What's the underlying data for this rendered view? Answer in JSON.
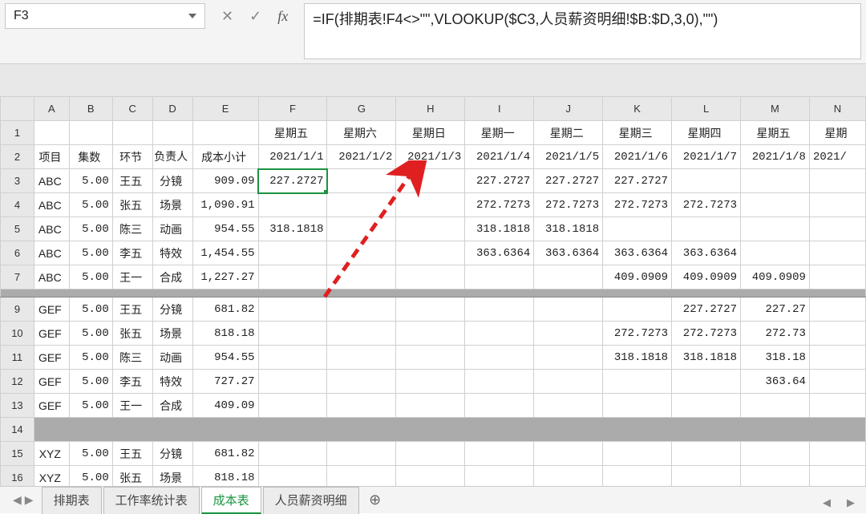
{
  "namebox": {
    "cell_ref": "F3"
  },
  "formula": "=IF(排期表!F4<>\"\",VLOOKUP($C3,人员薪资明细!$B:$D,3,0),\"\")",
  "col_headers": [
    "A",
    "B",
    "C",
    "D",
    "E",
    "F",
    "G",
    "H",
    "I",
    "J",
    "K",
    "L",
    "M",
    "N"
  ],
  "row1_headers": {
    "F": "星期五",
    "G": "星期六",
    "H": "星期日",
    "I": "星期一",
    "J": "星期二",
    "K": "星期三",
    "L": "星期四",
    "M": "星期五",
    "N": "星期"
  },
  "row2": {
    "A": "项目",
    "B": "集数",
    "C": "环节",
    "D": "负责人",
    "E": "成本小计",
    "F": "2021/1/1",
    "G": "2021/1/2",
    "H": "2021/1/3",
    "I": "2021/1/4",
    "J": "2021/1/5",
    "K": "2021/1/6",
    "L": "2021/1/7",
    "M": "2021/1/8",
    "N": "2021/"
  },
  "rows": [
    {
      "r": 3,
      "A": "ABC",
      "B": "5.00",
      "C": "王五",
      "D": "分镜",
      "E": "909.09",
      "F": "227.2727",
      "I": "227.2727",
      "J": "227.2727",
      "K": "227.2727"
    },
    {
      "r": 4,
      "A": "ABC",
      "B": "5.00",
      "C": "张五",
      "D": "场景",
      "E": "1,090.91",
      "I": "272.7273",
      "J": "272.7273",
      "K": "272.7273",
      "L": "272.7273"
    },
    {
      "r": 5,
      "A": "ABC",
      "B": "5.00",
      "C": "陈三",
      "D": "动画",
      "E": "954.55",
      "F": "318.1818",
      "I": "318.1818",
      "J": "318.1818"
    },
    {
      "r": 6,
      "A": "ABC",
      "B": "5.00",
      "C": "李五",
      "D": "特效",
      "E": "1,454.55",
      "I": "363.6364",
      "J": "363.6364",
      "K": "363.6364",
      "L": "363.6364"
    },
    {
      "r": 7,
      "A": "ABC",
      "B": "5.00",
      "C": "王一",
      "D": "合成",
      "E": "1,227.27",
      "K": "409.0909",
      "L": "409.0909",
      "M": "409.0909"
    },
    {
      "spacer": true
    },
    {
      "r": 9,
      "A": "GEF",
      "B": "5.00",
      "C": "王五",
      "D": "分镜",
      "E": "681.82",
      "L": "227.2727",
      "M_big": "227.27"
    },
    {
      "r": 10,
      "A": "GEF",
      "B": "5.00",
      "C": "张五",
      "D": "场景",
      "E": "818.18",
      "K": "272.7273",
      "L": "272.7273",
      "M_big": "272.73"
    },
    {
      "r": 11,
      "A": "GEF",
      "B": "5.00",
      "C": "陈三",
      "D": "动画",
      "E": "954.55",
      "K": "318.1818",
      "L": "318.1818",
      "M_big": "318.18"
    },
    {
      "r": 12,
      "A": "GEF",
      "B": "5.00",
      "C": "李五",
      "D": "特效",
      "E": "727.27",
      "M_big": "363.64"
    },
    {
      "r": 13,
      "A": "GEF",
      "B": "5.00",
      "C": "王一",
      "D": "合成",
      "E": "409.09"
    },
    {
      "spacer_thin": true,
      "r": 14
    },
    {
      "r": 15,
      "A": "XYZ",
      "B": "5.00",
      "C": "王五",
      "D": "分镜",
      "E": "681.82"
    },
    {
      "r": 16,
      "A": "XYZ",
      "B": "5.00",
      "C": "张五",
      "D": "场景",
      "E": "818.18"
    }
  ],
  "selected_cell": "F3",
  "sheet_tabs": [
    {
      "label": "排期表",
      "active": false
    },
    {
      "label": "工作率统计表",
      "active": false
    },
    {
      "label": "成本表",
      "active": true
    },
    {
      "label": "人员薪资明细",
      "active": false
    }
  ],
  "chart_data": {
    "type": "table"
  }
}
